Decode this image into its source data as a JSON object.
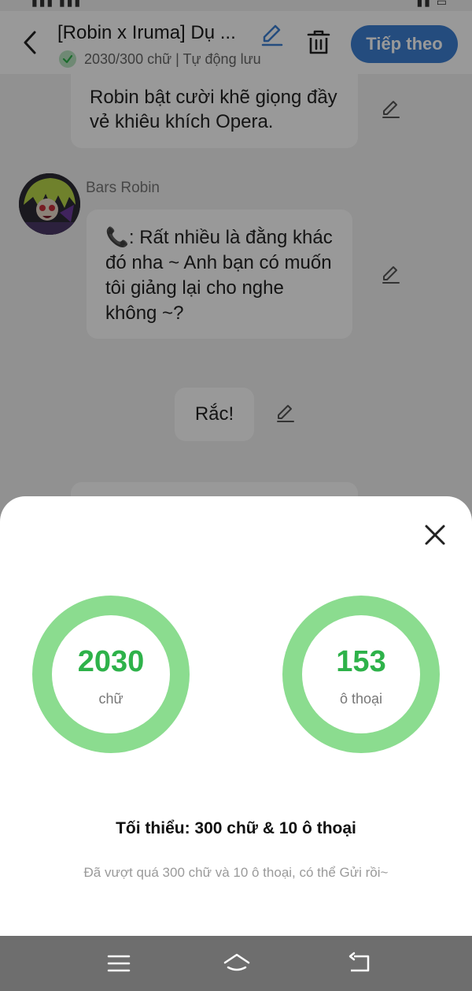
{
  "header": {
    "title": "[Robin x Iruma] Dụ ...",
    "status_text": "2030/300 chữ | Tự động lưu",
    "next_label": "Tiếp theo"
  },
  "messages": [
    {
      "text": "Robin bật cười khẽ giọng đầy vẻ khiêu khích Opera."
    },
    {
      "sender": "Bars Robin",
      "text": "📞: Rất nhiều là đằng khác đó nha ~ Anh bạn có muốn tôi giảng lại cho nghe không ~?"
    },
    {
      "text": "Rắc!"
    }
  ],
  "sheet": {
    "words": {
      "value": "2030",
      "label": "chữ"
    },
    "dialogs": {
      "value": "153",
      "label": "ô thoại"
    },
    "requirement": "Tối thiểu: 300 chữ & 10 ô thoại",
    "hint": "Đã vượt quá 300 chữ và 10 ô thoại, có thể Gửi rồi~"
  },
  "colors": {
    "accent": "#3d7fd2",
    "ring": "#8bdc8f",
    "ring_text": "#2eb24a"
  },
  "icons": [
    "back-arrow-icon",
    "pencil-icon",
    "check-icon",
    "trash-icon",
    "close-icon",
    "menu-icon",
    "home-icon",
    "back-icon"
  ]
}
